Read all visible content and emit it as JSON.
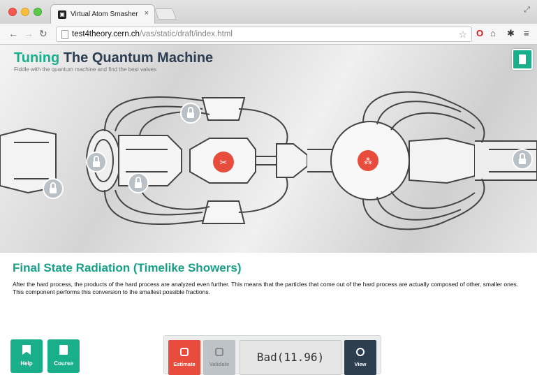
{
  "browser": {
    "tab_title": "Virtual Atom Smasher",
    "tab_close": "×",
    "url_host": "test4theory.cern.ch",
    "url_path": "/vas/static/draft/index.html"
  },
  "header": {
    "title_accent": "Tuning",
    "title_rest": "The Quantum Machine",
    "subtitle": "Fiddle with the quantum machine and find the best values"
  },
  "section": {
    "title": "Final State Radiation (Timelike Showers)",
    "description": "After the hard process, the products of the hard process are analyzed even further. This means that the particles that come out of the hard process are actually composed of other, smaller ones. This component performs this conversion to the smallest possible fractions."
  },
  "side_buttons": {
    "help": "Help",
    "course": "Course"
  },
  "actions": {
    "estimate": "Estimate",
    "validate": "Validate",
    "result": "Bad(11.96)",
    "view": "View"
  },
  "icons": {
    "lock": "lock-icon",
    "scissors": "scissors-icon",
    "particles": "particles-icon",
    "bookmark": "bookmark-icon"
  },
  "colors": {
    "accent": "#1aaf8b",
    "title_dark": "#2c3e50",
    "estimate": "#e74c3c",
    "node_red": "#e74c3c",
    "validate_disabled": "#bdc3c7",
    "view": "#2c3e50"
  }
}
